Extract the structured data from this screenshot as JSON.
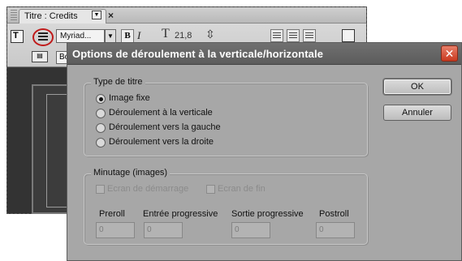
{
  "background_window": {
    "tab_title": "Titre : Credits",
    "toolbar": {
      "font_name": "Myriad...",
      "bold_label": "B",
      "italic_label": "I",
      "size_icon": "T",
      "font_size": "21,8",
      "row2_partial": "Bo"
    }
  },
  "dialog": {
    "title": "Options de déroulement à la verticale/horizontale",
    "close_icon": "close-x",
    "title_type": {
      "legend": "Type de titre",
      "options": [
        {
          "label": "Image fixe",
          "checked": true
        },
        {
          "label": "Déroulement à la verticale",
          "checked": false
        },
        {
          "label": "Déroulement vers la gauche",
          "checked": false
        },
        {
          "label": "Déroulement vers la droite",
          "checked": false
        }
      ]
    },
    "timing": {
      "legend": "Minutage (images)",
      "start_screen_label": "Ecran de démarrage",
      "end_screen_label": "Ecran de fin",
      "columns": [
        "Preroll",
        "Entrée progressive",
        "Sortie progressive",
        "Postroll"
      ],
      "values": [
        "0",
        "0",
        "0",
        "0"
      ]
    },
    "buttons": {
      "ok": "OK",
      "cancel": "Annuler"
    }
  }
}
